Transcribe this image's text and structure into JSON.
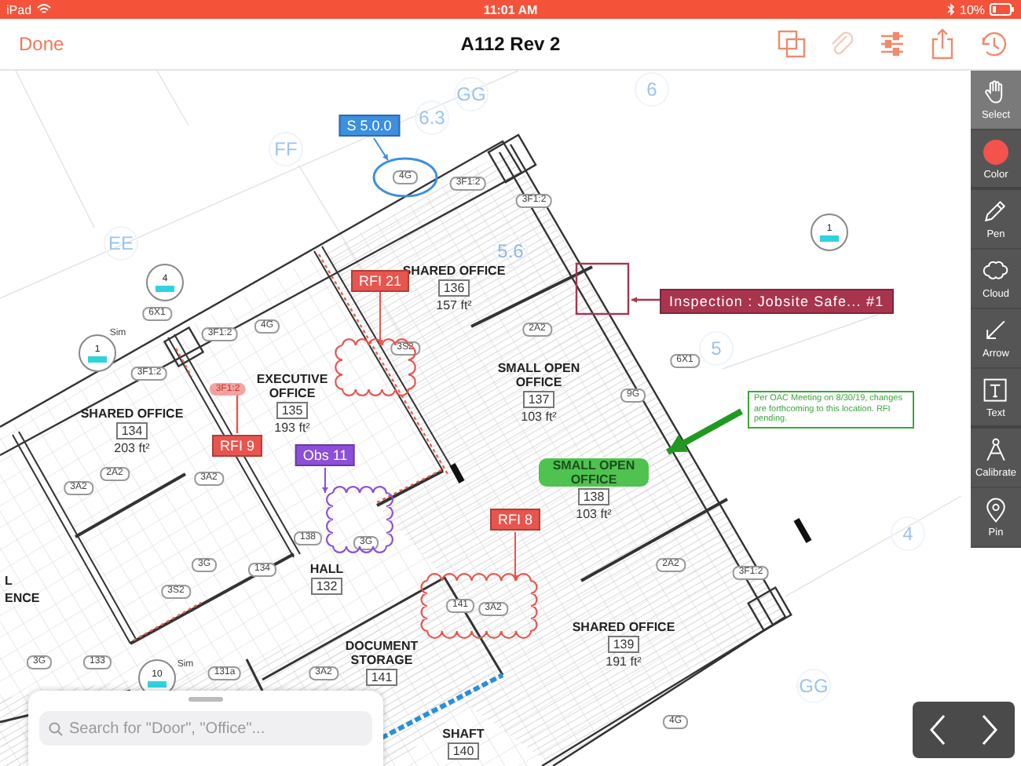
{
  "status_bar": {
    "device": "iPad",
    "time": "11:01 AM",
    "battery": "10%"
  },
  "nav_bar": {
    "done": "Done",
    "title": "A112 Rev 2",
    "actions": [
      {
        "kind": "layers",
        "disabled": false
      },
      {
        "kind": "attach",
        "disabled": true
      },
      {
        "kind": "filters",
        "disabled": false
      },
      {
        "kind": "share",
        "disabled": false
      },
      {
        "kind": "history",
        "disabled": false
      }
    ]
  },
  "plan": {
    "grid_bubbles": [
      "FF",
      "6.3",
      "GG",
      "EE",
      "5.6",
      "6",
      "5",
      "4",
      "GG"
    ],
    "rooms": [
      {
        "name": "SHARED OFFICE",
        "number": "136",
        "area": "157 ft²",
        "highlighted": false
      },
      {
        "name": "EXECUTIVE OFFICE",
        "number": "135",
        "area": "193 ft²",
        "highlighted": false
      },
      {
        "name": "SHARED OFFICE",
        "number": "134",
        "area": "203 ft²",
        "highlighted": false
      },
      {
        "name": "SMALL OPEN OFFICE",
        "number": "137",
        "area": "103 ft²",
        "highlighted": false
      },
      {
        "name": "SMALL OPEN OFFICE",
        "number": "138",
        "area": "103 ft²",
        "highlighted": true
      },
      {
        "name": "HALL",
        "number": "132",
        "highlighted": false
      },
      {
        "name": "DOCUMENT STORAGE",
        "number": "141",
        "highlighted": false
      },
      {
        "name": "SHARED OFFICE",
        "number": "139",
        "area": "191 ft²",
        "highlighted": false
      },
      {
        "name": "SHAFT",
        "number": "140",
        "highlighted": false
      }
    ],
    "tags": [
      {
        "text": "4G",
        "kind": "pill"
      },
      {
        "text": "3F1:2",
        "kind": "pill"
      },
      {
        "text": "3F1:2",
        "kind": "pill"
      },
      {
        "text": "6X1",
        "kind": "pill"
      },
      {
        "text": "3F1:2",
        "kind": "pill"
      },
      {
        "text": "4G",
        "kind": "pill"
      },
      {
        "text": "3F1:2",
        "kind": "pill"
      },
      {
        "text": "3S2",
        "kind": "pill"
      },
      {
        "text": "2A2",
        "kind": "pill"
      },
      {
        "text": "6X1",
        "kind": "pill"
      },
      {
        "text": "9G",
        "kind": "pill"
      },
      {
        "text": "3A2",
        "kind": "pill"
      },
      {
        "text": "2A2",
        "kind": "pill"
      },
      {
        "text": "3A2",
        "kind": "pill"
      },
      {
        "text": "3G",
        "kind": "pill"
      },
      {
        "text": "134",
        "kind": "pill"
      },
      {
        "text": "138",
        "kind": "pill"
      },
      {
        "text": "3G",
        "kind": "pill"
      },
      {
        "text": "3S2",
        "kind": "pill"
      },
      {
        "text": "141",
        "kind": "pill"
      },
      {
        "text": "3A2",
        "kind": "pill"
      },
      {
        "text": "3G",
        "kind": "pill"
      },
      {
        "text": "133",
        "kind": "pill"
      },
      {
        "text": "131a",
        "kind": "pill"
      },
      {
        "text": "3A2",
        "kind": "pill"
      },
      {
        "text": "2A2",
        "kind": "pill"
      },
      {
        "text": "3F1:2",
        "kind": "pill"
      },
      {
        "text": "4G",
        "kind": "pill"
      },
      {
        "text": "Sim",
        "kind": "plain"
      },
      {
        "text": "Sim",
        "kind": "plain"
      },
      {
        "text": "L",
        "kind": "room"
      },
      {
        "text": "ENCE",
        "kind": "room"
      }
    ],
    "markers": [
      {
        "number": "4"
      },
      {
        "number": "1"
      },
      {
        "number": "10"
      },
      {
        "number": "1"
      }
    ],
    "markups": [
      {
        "kind": "ellipse",
        "label": "S 5.0.0",
        "color": "#3d8fe0"
      },
      {
        "kind": "cloud",
        "label": "RFI 21",
        "color": "#e8554e"
      },
      {
        "kind": "highlight",
        "label": "RFI 9",
        "target": "3F1:2",
        "color": "#e8554e"
      },
      {
        "kind": "cloud",
        "label": "Obs 11",
        "color": "#8b4fd8"
      },
      {
        "kind": "cloud",
        "label": "RFI 8",
        "color": "#e8554e"
      },
      {
        "kind": "rectangle",
        "label": "Inspection : Jobsite Safe... #1",
        "color": "#a8344e"
      },
      {
        "kind": "arrow",
        "color": "#1f9a1f"
      },
      {
        "kind": "note",
        "text": "Per OAC Meeting on 8/30/19, changes are forthcoming to this location. RFI pending.",
        "color": "#3aa63a"
      }
    ]
  },
  "toolbar": [
    {
      "kind": "select",
      "label": "Select",
      "selected": true
    },
    {
      "kind": "color",
      "label": "Color",
      "selected": false,
      "color": "#f4524d"
    },
    {
      "kind": "pen",
      "label": "Pen",
      "selected": false
    },
    {
      "kind": "cloud",
      "label": "Cloud",
      "selected": false
    },
    {
      "kind": "arrow",
      "label": "Arrow",
      "selected": false
    },
    {
      "kind": "text",
      "label": "Text",
      "selected": false
    },
    {
      "kind": "calibrate",
      "label": "Calibrate",
      "selected": false
    },
    {
      "kind": "pin",
      "label": "Pin",
      "selected": false
    }
  ],
  "search": {
    "placeholder": "Search for \"Door\", \"Office\"..."
  }
}
